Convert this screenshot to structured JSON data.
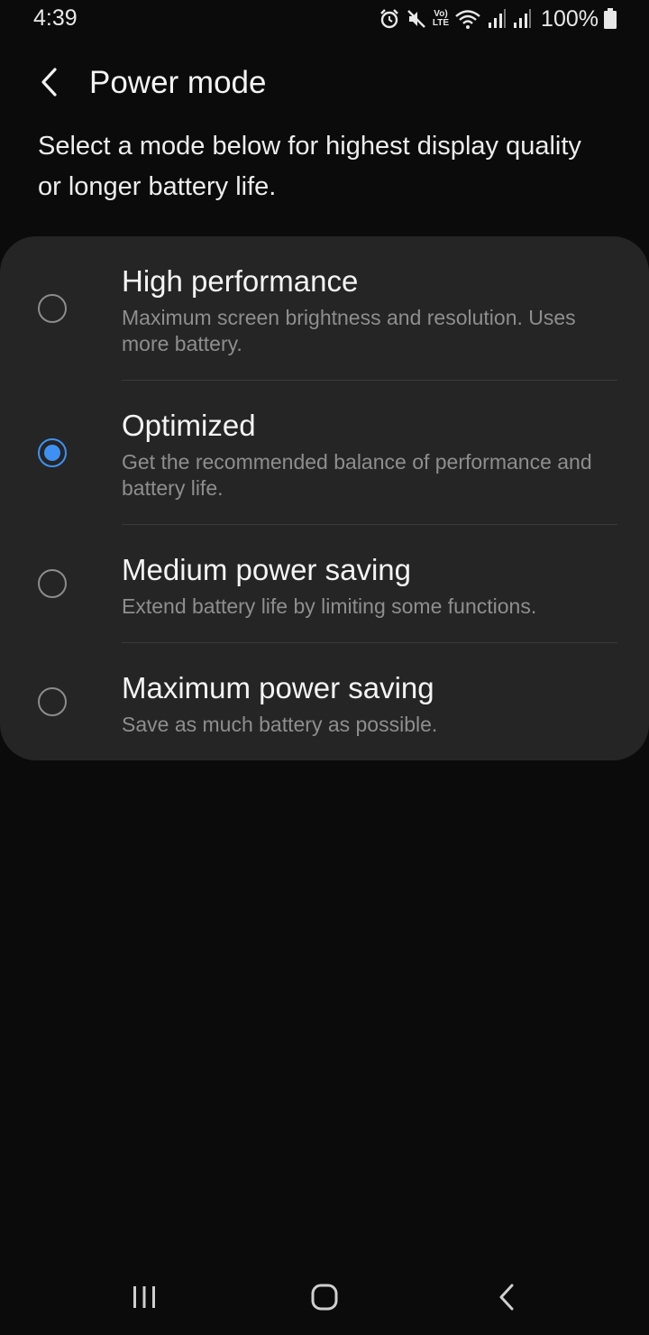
{
  "status_bar": {
    "time": "4:39",
    "volte_top": "Vo)",
    "volte_bottom": "LTE",
    "battery_percent": "100%",
    "icons": [
      "alarm-icon",
      "mute-icon",
      "volte-icon",
      "wifi-icon",
      "signal-icon",
      "signal-icon",
      "battery-icon"
    ]
  },
  "header": {
    "title": "Power mode",
    "back_icon": "chevron-left-icon"
  },
  "description": "Select a mode below for highest display quality or longer battery life.",
  "options": [
    {
      "title": "High performance",
      "description": "Maximum screen brightness and resolution. Uses more battery.",
      "selected": false
    },
    {
      "title": "Optimized",
      "description": "Get the recommended balance of performance and battery life.",
      "selected": true
    },
    {
      "title": "Medium power saving",
      "description": "Extend battery life by limiting some functions.",
      "selected": false
    },
    {
      "title": "Maximum power saving",
      "description": "Save as much battery as possible.",
      "selected": false
    }
  ],
  "nav_bar": {
    "recents_icon": "recents-icon",
    "home_icon": "home-icon",
    "back_icon": "back-icon"
  },
  "colors": {
    "background": "#0b0b0b",
    "card": "#252525",
    "accent": "#3e91f2",
    "secondary_text": "#8e8e8e"
  }
}
